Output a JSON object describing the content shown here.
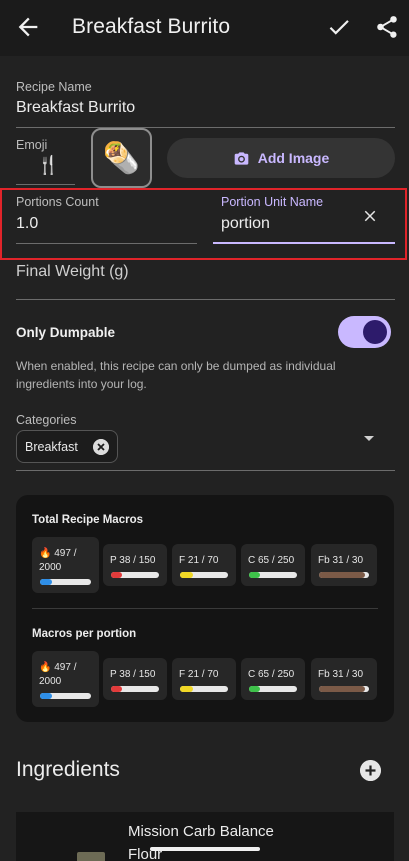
{
  "appbar": {
    "title": "Breakfast Burrito"
  },
  "recipe_name": {
    "label": "Recipe Name",
    "value": "Breakfast Burrito"
  },
  "emoji": {
    "label": "Emoji",
    "value": "🍴",
    "selected": "🌯"
  },
  "add_image": {
    "label": "Add Image"
  },
  "portions": {
    "count_label": "Portions Count",
    "count_value": "1.0",
    "unit_label": "Portion Unit Name",
    "unit_value": "portion"
  },
  "final_weight": {
    "label": "Final Weight (g)"
  },
  "dumpable": {
    "label": "Only Dumpable",
    "enabled": true,
    "helper": "When enabled, this recipe can only be dumped as individual ingredients into your log."
  },
  "categories": {
    "label": "Categories",
    "chips": [
      "Breakfast"
    ]
  },
  "macros": {
    "total_title": "Total Recipe Macros",
    "per_portion_title": "Macros per portion",
    "total": [
      {
        "text": "🔥 497 /\n2000",
        "ratio": 0.25,
        "color": "#2f8fe8"
      },
      {
        "text": "P 38 / 150",
        "ratio": 0.25,
        "color": "#e23b3b"
      },
      {
        "text": "F 21 / 70",
        "ratio": 0.3,
        "color": "#f1d826"
      },
      {
        "text": "C 65 / 250",
        "ratio": 0.26,
        "color": "#3ec24a"
      },
      {
        "text": "Fb 31 / 30",
        "ratio": 1.0,
        "color": "#7b5a47"
      }
    ],
    "per_portion": [
      {
        "text": "🔥 497 /\n2000",
        "ratio": 0.25,
        "color": "#2f8fe8"
      },
      {
        "text": "P 38 / 150",
        "ratio": 0.25,
        "color": "#e23b3b"
      },
      {
        "text": "F 21 / 70",
        "ratio": 0.3,
        "color": "#f1d826"
      },
      {
        "text": "C 65 / 250",
        "ratio": 0.26,
        "color": "#3ec24a"
      },
      {
        "text": "Fb 31 / 30",
        "ratio": 1.0,
        "color": "#7b5a47"
      }
    ]
  },
  "ingredients": {
    "title": "Ingredients",
    "items": [
      {
        "name": "Mission Carb Balance Flour"
      }
    ]
  }
}
